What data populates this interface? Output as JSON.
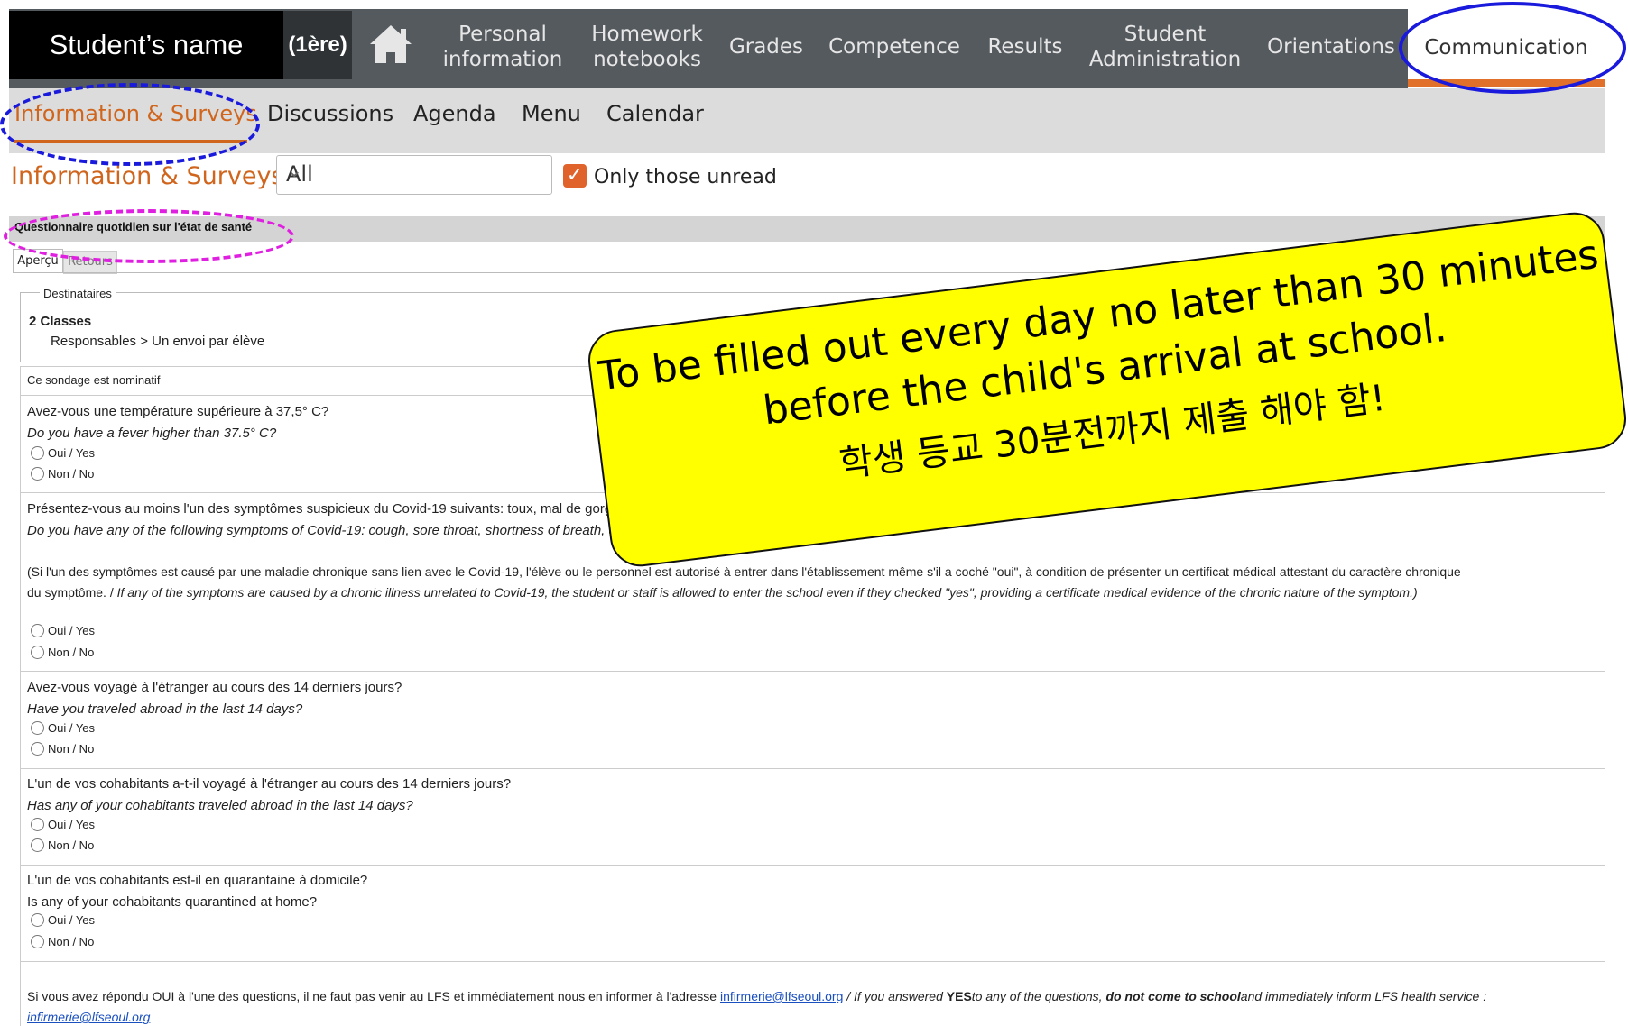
{
  "top_nav": {
    "student_name": "Student’s name",
    "class_tag": "(1ère)",
    "items": [
      {
        "label_line1": "Personal",
        "label_line2": "information"
      },
      {
        "label_line1": "Homework",
        "label_line2": "notebooks"
      },
      {
        "label": "Grades"
      },
      {
        "label": "Competence"
      },
      {
        "label": "Results"
      },
      {
        "label_line1": "Student",
        "label_line2": "Administration"
      },
      {
        "label": "Orientations"
      },
      {
        "label": "Communication",
        "active": true
      }
    ]
  },
  "sub_nav": {
    "items": [
      "Information & Surveys",
      "Discussions",
      "Agenda",
      "Menu",
      "Calendar"
    ],
    "active": "Information & Surveys"
  },
  "filter": {
    "section_title": "Information & Surveys",
    "select_value": "All",
    "only_unread_label": "Only those unread",
    "only_unread_checked": true
  },
  "survey": {
    "title": "Questionnaire quotidien sur l'état de santé",
    "tabs": [
      "Aperçu",
      "Retours"
    ],
    "recipients_label": "Destinataires",
    "classes": "2 Classes",
    "responsables": "Responsables > Un envoi par élève",
    "nominative": "Ce sondage est nominatif",
    "option_yes": "Oui / Yes",
    "option_no": "Non / No",
    "questions": [
      {
        "fr": "Avez-vous une température supérieure à 37,5° C?",
        "en": "Do you have a fever higher than 37.5° C?"
      },
      {
        "fr": "Présentez-vous au moins l'un des symptômes suspicieux du Covid-19 suivants: toux, mal de gorge, difficulté à respirer, diarrhée, nausée, perte de goût et/ou de l'odorat?",
        "en": "Do you have any of the following symptoms of Covid-19: cough, sore throat, shortness of breath, diarrhea, nausea, loss of taste and/or smell?",
        "note_fr_1": "(Si l'un des symptômes est causé par une maladie chronique sans lien avec le Covid-19, l'élève ou le personnel est autorisé à entrer dans l'établissement même s'il a coché \"oui\", à condition de présenter un certificat médical attestant du caractère chronique",
        "note_fr_2": "du symptôme. /",
        "note_en": "If any of the symptoms are caused by a chronic illness unrelated to Covid-19, the student or staff is allowed to enter the school even if they checked \"yes\", providing a certificate medical evidence of the chronic nature of the symptom.)"
      },
      {
        "fr": "Avez-vous voyagé à l'étranger au cours des 14 derniers jours?",
        "en": "Have you traveled abroad in the last 14 days?"
      },
      {
        "fr": "L'un de vos cohabitants a-t-il voyagé à l'étranger au cours des 14 derniers jours?",
        "en": "Has any of your cohabitants traveled abroad in the last 14 days?"
      },
      {
        "fr": "L'un de vos cohabitants est-il en quarantaine à domicile?",
        "en": "Is any of your cohabitants quarantined at home?"
      }
    ],
    "footer": {
      "fr_text": "Si vous avez répondu OUI à l'une des questions, il ne faut pas venir au LFS et immédiatement nous en informer à l'adresse",
      "email": "infirmerie@lfseoul.org",
      "en_pre": " / If you answered ",
      "en_yes": "YES",
      "en_mid": "to any of the questions, ",
      "en_bold": "do not come to school",
      "en_post": "and immediately inform LFS health service :",
      "email2": "infirmerie@lfseoul.org"
    }
  },
  "callout": {
    "line1": "To be filled out every day no later than 30 minutes",
    "line2": "before the child's arrival at school.",
    "line3": "학생 등교 30분전까지 제출 해야 함!"
  },
  "colors": {
    "accent": "#d0661e",
    "nav_bg": "#555a5f",
    "callout_bg": "#ffff00",
    "annot_blue": "#1a1adc",
    "annot_magenta": "#e020e0"
  }
}
